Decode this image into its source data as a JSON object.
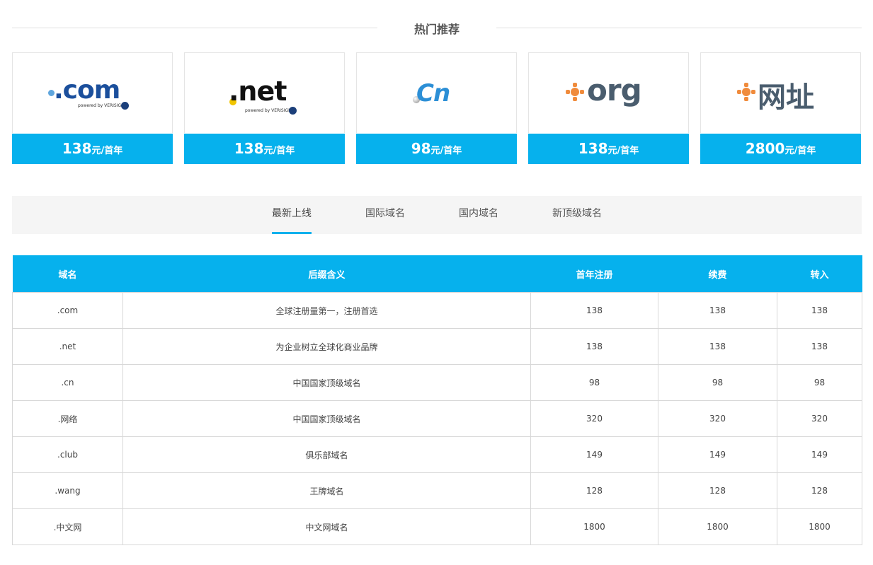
{
  "section_title": "热门推荐",
  "cards": [
    {
      "logo_text": ".com",
      "powered": "powered by VERISIGN",
      "price": "138",
      "unit": "元/首年"
    },
    {
      "logo_text": ".net",
      "powered": "powered by VERISIGN",
      "price": "138",
      "unit": "元/首年"
    },
    {
      "logo_text": "Cn",
      "price": "98",
      "unit": "元/首年"
    },
    {
      "logo_text": "org",
      "price": "138",
      "unit": "元/首年"
    },
    {
      "logo_text": "网址",
      "price": "2800",
      "unit": "元/首年"
    }
  ],
  "tabs": [
    {
      "label": "最新上线",
      "active": true
    },
    {
      "label": "国际域名",
      "active": false
    },
    {
      "label": "国内域名",
      "active": false
    },
    {
      "label": "新顶级域名",
      "active": false
    }
  ],
  "table": {
    "headers": [
      "域名",
      "后缀含义",
      "首年注册",
      "续费",
      "转入"
    ],
    "rows": [
      [
        ".com",
        "全球注册量第一，注册首选",
        "138",
        "138",
        "138"
      ],
      [
        ".net",
        "为企业树立全球化商业品牌",
        "138",
        "138",
        "138"
      ],
      [
        ".cn",
        "中国国家顶级域名",
        "98",
        "98",
        "98"
      ],
      [
        ".网络",
        "中国国家顶级域名",
        "320",
        "320",
        "320"
      ],
      [
        ".club",
        "俱乐部域名",
        "149",
        "149",
        "149"
      ],
      [
        ".wang",
        "王牌域名",
        "128",
        "128",
        "128"
      ],
      [
        ".中文网",
        "中文网域名",
        "1800",
        "1800",
        "1800"
      ]
    ]
  },
  "colors": {
    "accent": "#06b1ed",
    "com_blue": "#1b4f9c",
    "org_slate": "#4a5d6e",
    "org_orange": "#f08b3c"
  },
  "icons": [
    "verisign-badge-icon",
    "orange-cross-icon"
  ]
}
